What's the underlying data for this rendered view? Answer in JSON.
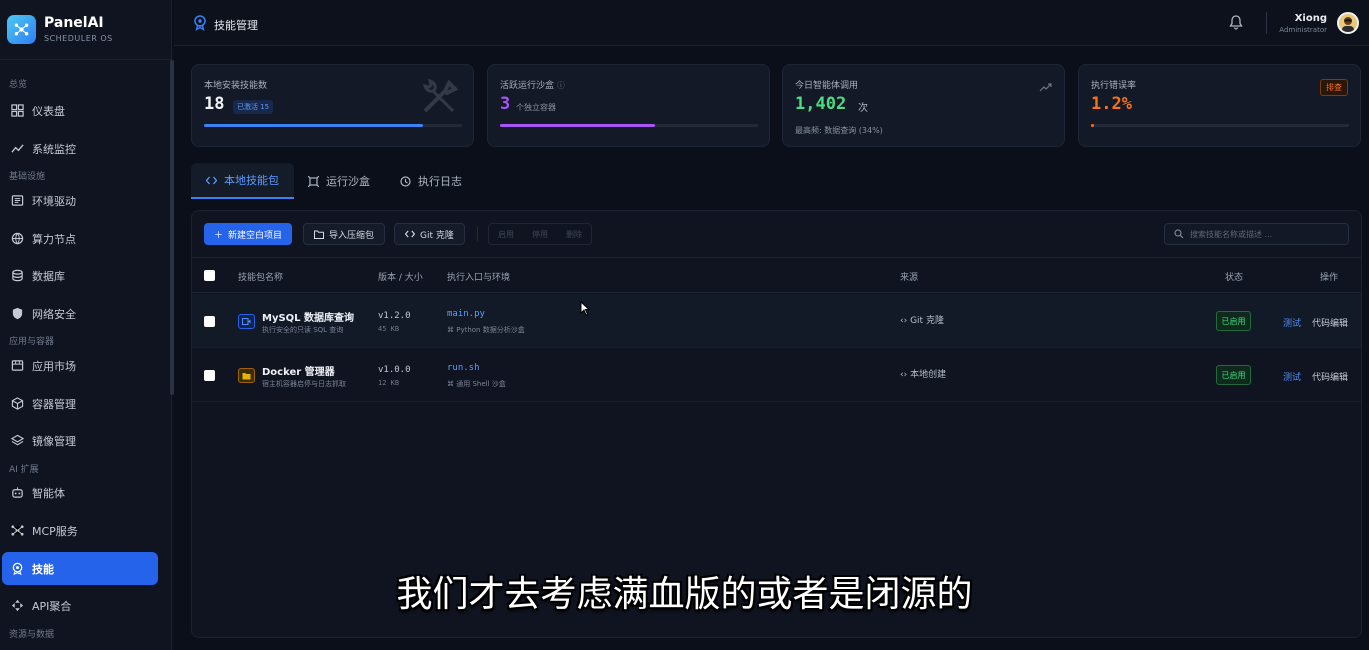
{
  "brand": {
    "name": "PanelAI",
    "sub": "SCHEDULER OS"
  },
  "sidebar": {
    "sections": [
      {
        "label": "总览"
      },
      {
        "label": "基础设施"
      },
      {
        "label": "应用与容器"
      },
      {
        "label": "AI 扩展"
      },
      {
        "label": "资源与数据"
      }
    ],
    "items": [
      {
        "label": "仪表盘",
        "icon": "dashboard-icon"
      },
      {
        "label": "系统监控",
        "icon": "chart-line-icon"
      },
      {
        "label": "环境驱动",
        "icon": "driver-icon"
      },
      {
        "label": "算力节点",
        "icon": "globe-icon"
      },
      {
        "label": "数据库",
        "icon": "database-icon"
      },
      {
        "label": "网络安全",
        "icon": "shield-icon"
      },
      {
        "label": "应用市场",
        "icon": "store-icon"
      },
      {
        "label": "容器管理",
        "icon": "cube-icon"
      },
      {
        "label": "镜像管理",
        "icon": "layers-icon"
      },
      {
        "label": "智能体",
        "icon": "robot-icon"
      },
      {
        "label": "MCP服务",
        "icon": "network-icon"
      },
      {
        "label": "技能",
        "icon": "skill-icon",
        "active": true
      },
      {
        "label": "API聚合",
        "icon": "api-icon"
      }
    ]
  },
  "header": {
    "title": "技能管理",
    "user_name": "Xiong",
    "user_role": "Administrator"
  },
  "stats": [
    {
      "label": "本地安装技能数",
      "value": "18",
      "badge": "已激活 15",
      "progress": 0.85,
      "color": "#3b82f6"
    },
    {
      "label": "活跃运行沙盒",
      "value": "3",
      "sub": "个独立容器",
      "progress": 0.6,
      "color": "#a855f7"
    },
    {
      "label": "今日智能体调用",
      "value": "1,402",
      "unit": "次",
      "sub": "最高频: 数据查询 (34%)",
      "color": "#22c55e"
    },
    {
      "label": "执行错误率",
      "value": "1.2%",
      "badge": "排查",
      "progress": 0.012,
      "color": "#f97316"
    }
  ],
  "tabs": [
    {
      "label": "本地技能包",
      "active": true
    },
    {
      "label": "运行沙盒"
    },
    {
      "label": "执行日志"
    }
  ],
  "toolbar": {
    "new_label": "新建空白项目",
    "import_label": "导入压缩包",
    "git_label": "Git 克隆",
    "group": [
      "启用",
      "停用",
      "删除"
    ],
    "search_placeholder": "搜索技能名称或描述 ..."
  },
  "table": {
    "headers": [
      "技能包名称",
      "版本 / 大小",
      "执行入口与环境",
      "来源",
      "状态",
      "操作"
    ],
    "rows": [
      {
        "name": "MySQL 数据库查询",
        "desc": "执行安全的只读 SQL 查询",
        "version": "v1.2.0",
        "size": "45 KB",
        "entry": "main.py",
        "env": "Python 数据分析沙盒",
        "source": "Git 克隆",
        "status": "已启用",
        "test": "测试",
        "edit": "代码编辑",
        "icon_color": "#2563eb"
      },
      {
        "name": "Docker 管理器",
        "desc": "宿主机容器启停与日志抓取",
        "version": "v1.0.0",
        "size": "12 KB",
        "entry": "run.sh",
        "env": "通用 Shell 沙盒",
        "source": "本地创建",
        "status": "已启用",
        "test": "测试",
        "edit": "代码编辑",
        "icon_color": "#eab308"
      }
    ]
  },
  "caption": "我们才去考虑满血版的或者是闭源的"
}
